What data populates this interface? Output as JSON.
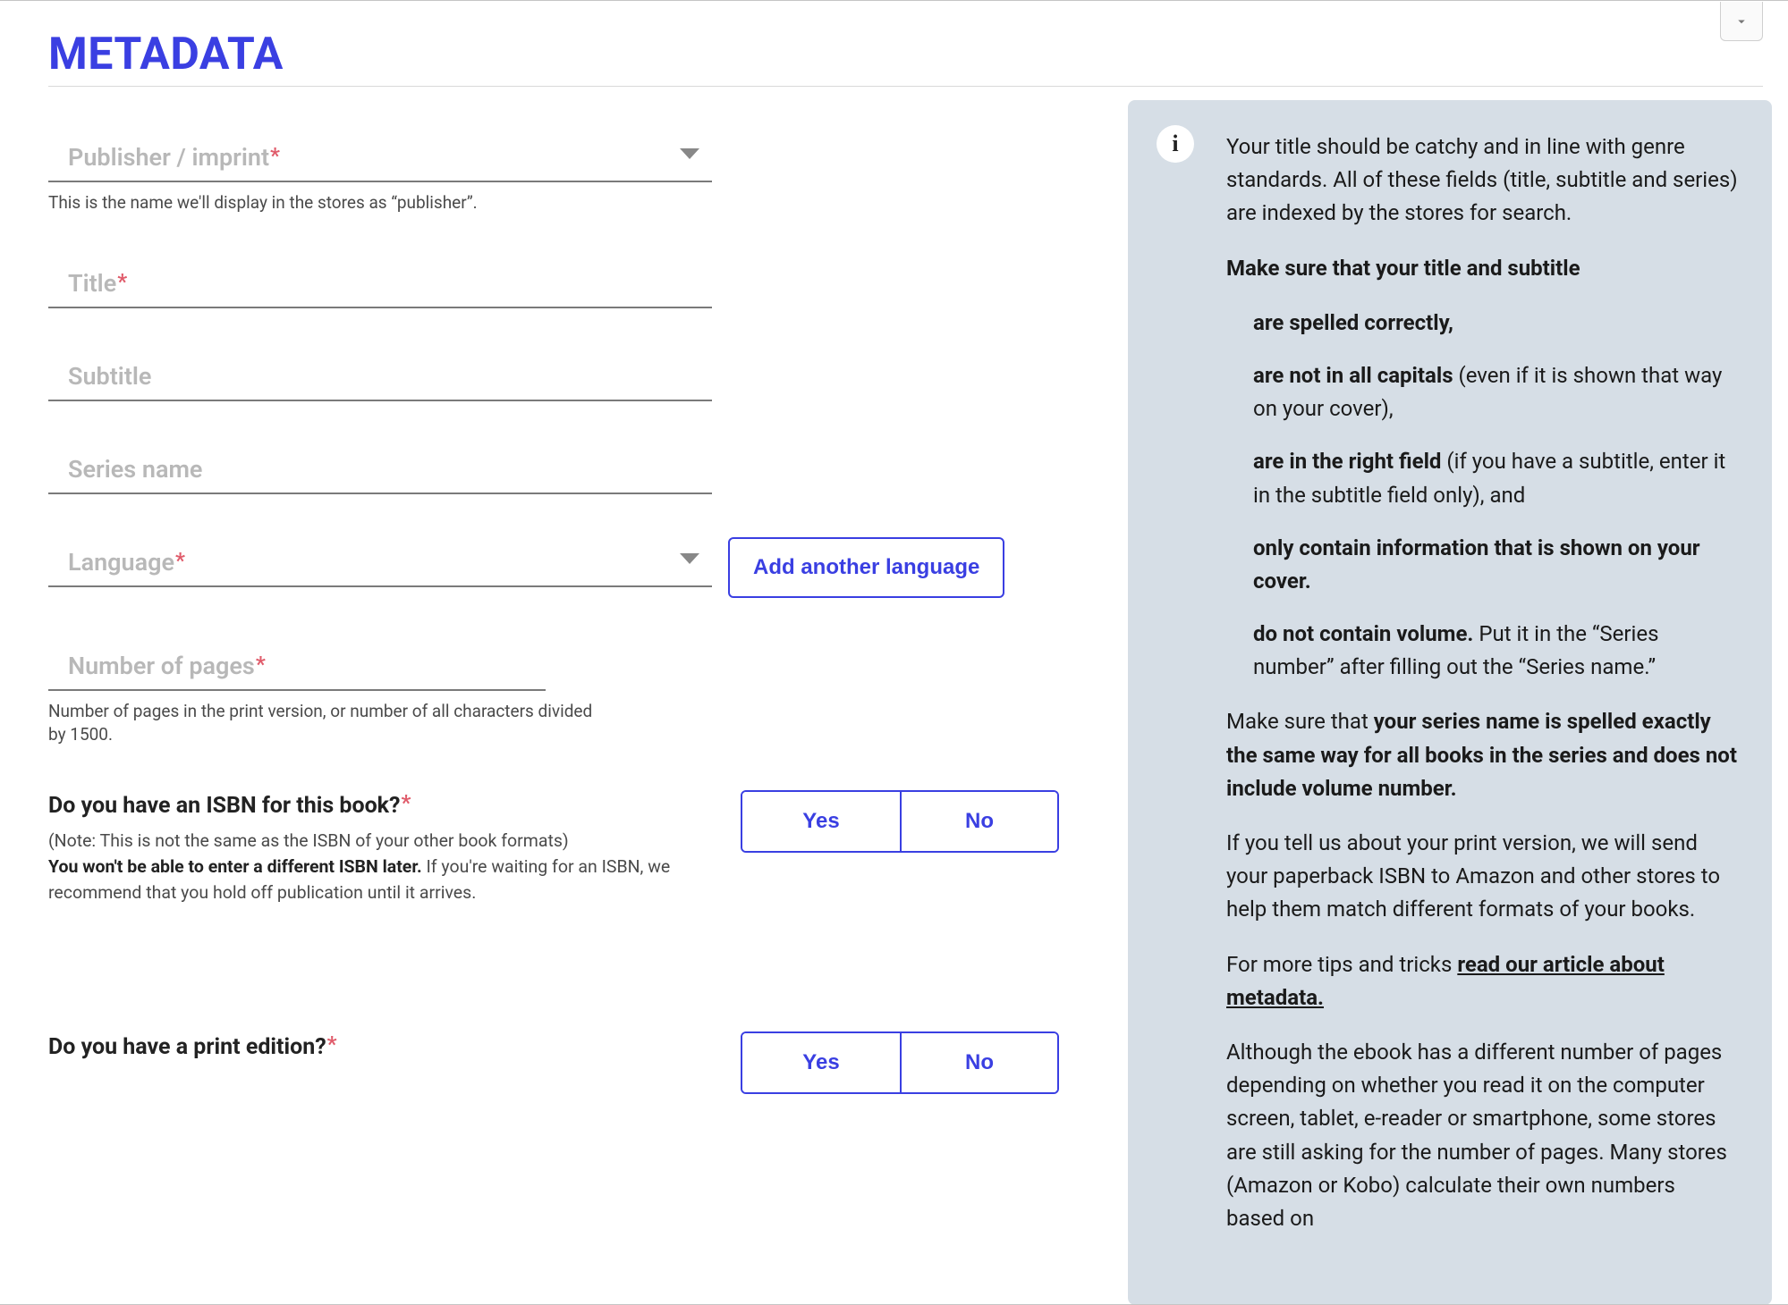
{
  "page": {
    "title": "METADATA"
  },
  "fields": {
    "publisher": {
      "placeholder": "Publisher / imprint",
      "required": "*",
      "help": "This is the name we'll display in the stores as “publisher”."
    },
    "title": {
      "placeholder": "Title",
      "required": "*"
    },
    "subtitle": {
      "placeholder": "Subtitle"
    },
    "series": {
      "placeholder": "Series name"
    },
    "language": {
      "placeholder": "Language",
      "required": "*",
      "add_btn": "Add another language"
    },
    "pages": {
      "placeholder": "Number of pages",
      "required": "*",
      "help": "Number of pages in the print version, or number of all characters divided by 1500."
    }
  },
  "questions": {
    "isbn": {
      "label": "Do you have an ISBN for this book?",
      "required": "*",
      "note_line1": "(Note: This is not the same as the ISBN of your other book formats)",
      "bold_line": "You won't be able to enter a different ISBN later.",
      "tail": " If you're waiting for an ISBN, we recommend that you hold off publication until it arrives.",
      "yes": "Yes",
      "no": "No"
    },
    "print": {
      "label": "Do you have a print edition?",
      "required": "*",
      "yes": "Yes",
      "no": "No"
    }
  },
  "info": {
    "intro": "Your title should be catchy and in line with genre standards. All of these fields (title, subtitle and series) are indexed by the stores for search.",
    "make_sure_lead": "Make sure that your title and subtitle",
    "bul1": "are spelled correctly,",
    "bul2_b": "are not in all capitals",
    "bul2_t": " (even if it is shown that way on your cover),",
    "bul3_b": "are in the right field",
    "bul3_t": " (if you have a subtitle, enter it in the subtitle field only), and",
    "bul4": "only contain information that is shown on your cover.",
    "bul5_b": "do not contain volume.",
    "bul5_t": " Put it in the “Series number” after filling out the “Series name.”",
    "series_para_lead": "Make sure that ",
    "series_para_bold": "your series name is spelled exactly the same way for all books in the series and does not include volume number.",
    "print_para": "If you tell us about your print version, we will send your paperback ISBN to Amazon and other stores to help them match different formats of your books.",
    "tips_lead": "For more tips and tricks ",
    "tips_link": "read our article about metadata.",
    "pages_para": "Although the ebook has a different number of pages depending on whether you read it on the computer screen, tablet, e-reader or smartphone, some stores are still asking for the number of pages. Many stores (Amazon or Kobo) calculate their own numbers based on"
  }
}
